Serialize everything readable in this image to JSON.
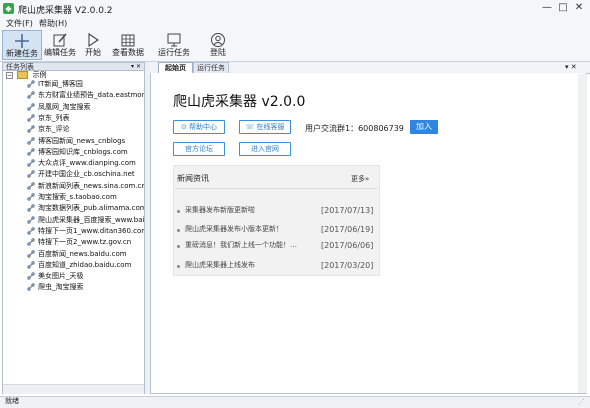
{
  "window": {
    "title": "爬山虎采集器 V2.0.0.2",
    "controls": [
      "—",
      "□",
      "✕"
    ]
  },
  "menu": {
    "items": [
      "文件(F)",
      "帮助(H)"
    ]
  },
  "toolbar": {
    "items": [
      {
        "label": "新建任务",
        "icon": "plus-icon"
      },
      {
        "label": "编辑任务",
        "icon": "edit-icon"
      },
      {
        "label": "开始",
        "icon": "play-icon"
      },
      {
        "label": "查看数据",
        "icon": "grid-icon"
      },
      {
        "label": "运行任务",
        "icon": "monitor-icon"
      },
      {
        "label": "登陆",
        "icon": "user-icon"
      }
    ]
  },
  "task_panel": {
    "title": "任务列表",
    "pin": "▾ ✕",
    "root": {
      "label": "示例",
      "toggle": "−"
    },
    "tasks": [
      "IT新闻_博客园",
      "东方财富业绩预告_data.eastmoney",
      "凤凰网_淘宝搜索",
      "京东_列表",
      "京东_评论",
      "博客园新闻_news_cnblogs",
      "博客园知识库_cnblogs.com",
      "大众点评_www.dianping.com",
      "开建中国企业_cb.oschina.net",
      "新浪新闻列表_news.sina.com.cn",
      "淘宝搜索_s.taobao.com",
      "淘宝数据列表_pub.alimama.com",
      "爬山虎采集器_百度搜索_www.baidu",
      "特搜下一页1_www.ditan360.com",
      "特搜下一页2_www.tz.gov.cn",
      "百度新闻_news.baidu.com",
      "百度知道_zhidao.baidu.com",
      "美女图片_天极",
      "爬虫_淘宝搜索"
    ]
  },
  "tabs": {
    "items": [
      "起始页",
      "运行任务"
    ],
    "active": 0,
    "close": "▾ ✕"
  },
  "start_page": {
    "title": "爬山虎采集器 v2.0.0",
    "buttons": {
      "help": "帮助中心",
      "support": "在线客服",
      "forum": "官方论坛",
      "website": "进入官网",
      "join": "加入"
    },
    "qq_group": "用户交流群1：600806739",
    "news": {
      "header": "新闻资讯",
      "more": "更多»",
      "items": [
        {
          "title": "采集器发布新版更新啦",
          "date": "[2017/07/13]"
        },
        {
          "title": "爬山虎采集器发布小版本更新！",
          "date": "[2017/06/19]"
        },
        {
          "title": "重磅消息！我们新上线一个功能！…",
          "date": "[2017/06/06]"
        },
        {
          "title": "爬山虎采集器上线发布",
          "date": "[2017/03/20]"
        }
      ]
    }
  },
  "status": {
    "text": "就绪"
  },
  "colors": {
    "accent": "#2e86e0",
    "link_border": "#3c8fd8",
    "selected_tool": "#d4e3f3"
  }
}
